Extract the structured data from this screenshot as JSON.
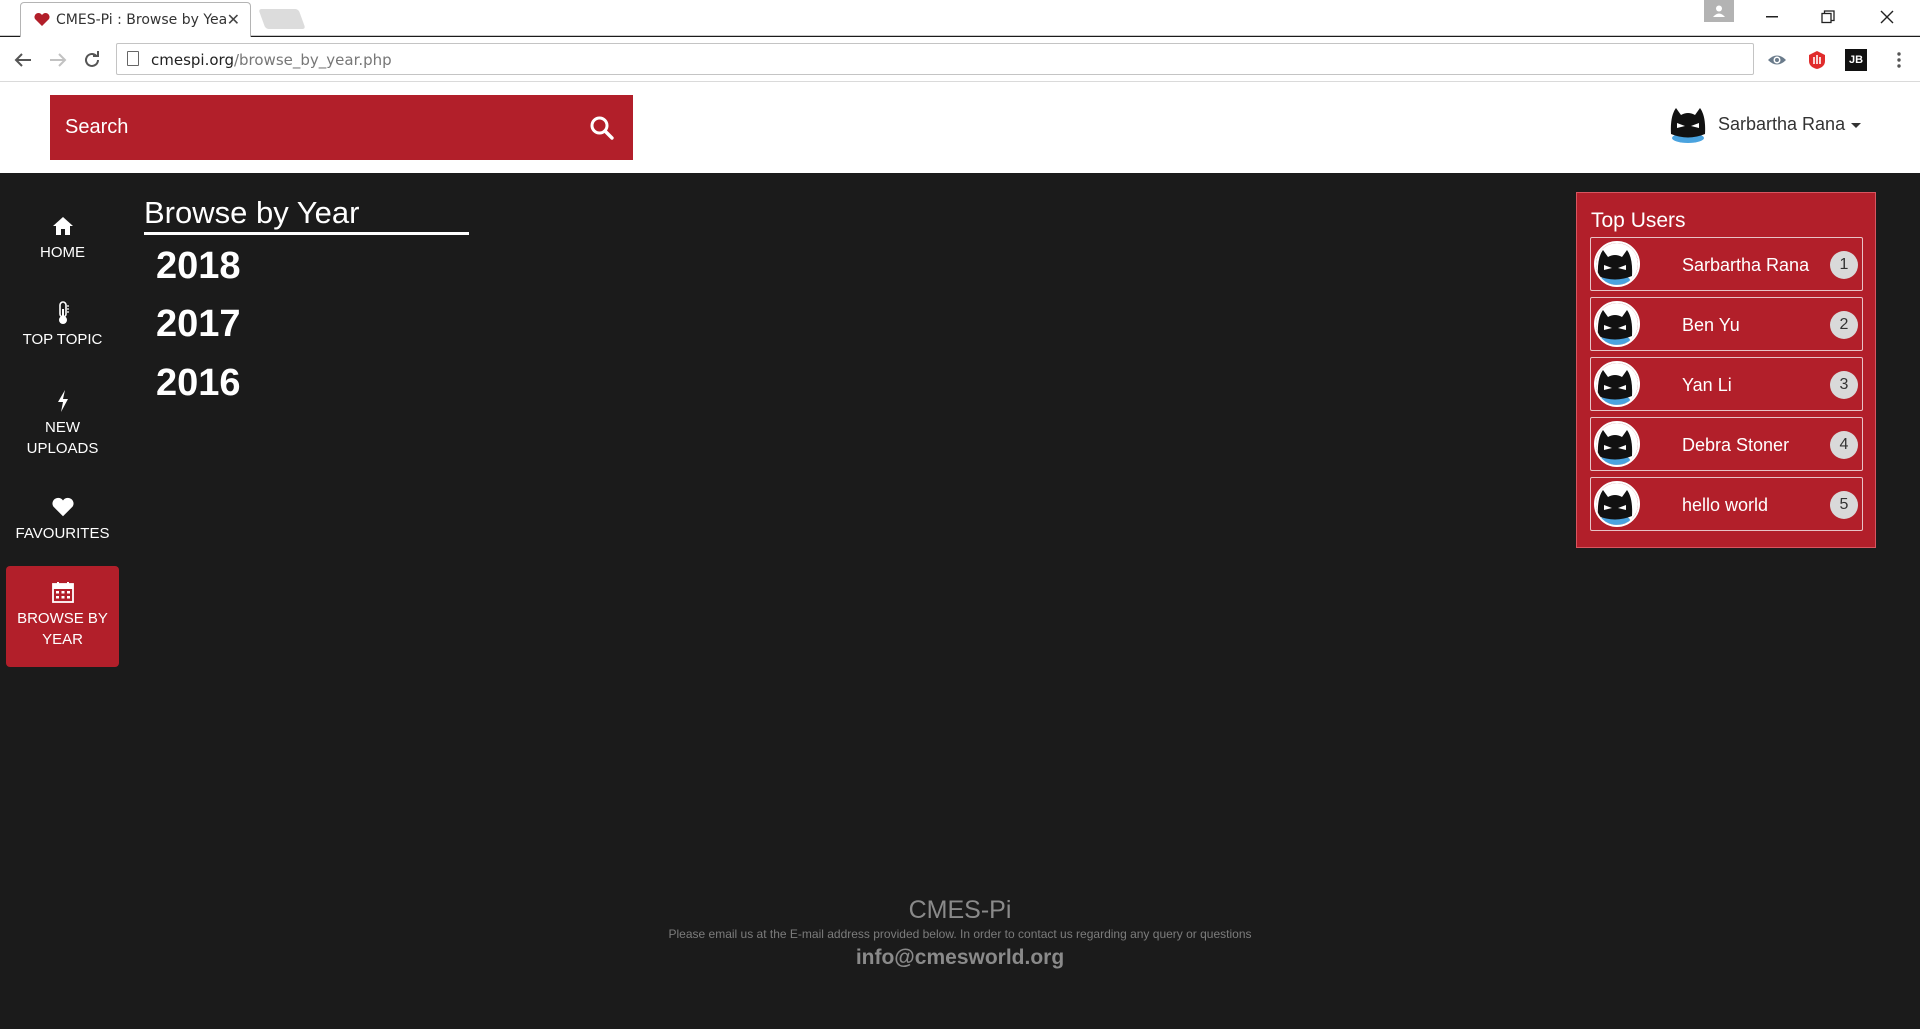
{
  "browser": {
    "tab_title": "CMES-Pi : Browse by Year",
    "url_host": "cmespi.org",
    "url_path": "/browse_by_year.php",
    "extensions": [
      "eye-extension-icon",
      "hand-extension-icon",
      "jetbrains-extension-icon"
    ],
    "ext_jb_label": "JB"
  },
  "header": {
    "search_placeholder": "Search",
    "user_name": "Sarbartha Rana"
  },
  "sidebar": {
    "items": [
      {
        "label": "HOME",
        "icon": "home-icon"
      },
      {
        "label": "TOP TOPIC",
        "icon": "thermometer-icon"
      },
      {
        "label": "NEW UPLOADS",
        "icon": "bolt-icon"
      },
      {
        "label": "FAVOURITES",
        "icon": "heart-icon"
      },
      {
        "label": "BROWSE BY YEAR",
        "icon": "calendar-icon",
        "active": true
      }
    ]
  },
  "main": {
    "title": "Browse by Year",
    "years": [
      "2018",
      "2017",
      "2016"
    ]
  },
  "top_users": {
    "title": "Top Users",
    "users": [
      {
        "name": "Sarbartha Rana",
        "rank": "1"
      },
      {
        "name": "Ben Yu",
        "rank": "2"
      },
      {
        "name": "Yan Li",
        "rank": "3"
      },
      {
        "name": "Debra Stoner",
        "rank": "4"
      },
      {
        "name": "hello world",
        "rank": "5"
      }
    ]
  },
  "footer": {
    "brand": "CMES-Pi",
    "note": "Please email us at the E-mail address provided below. In order to contact us regarding any query or questions",
    "email": "info@cmesworld.org"
  },
  "colors": {
    "brand_red": "#b21f2a",
    "page_bg": "#1b1b1b"
  }
}
